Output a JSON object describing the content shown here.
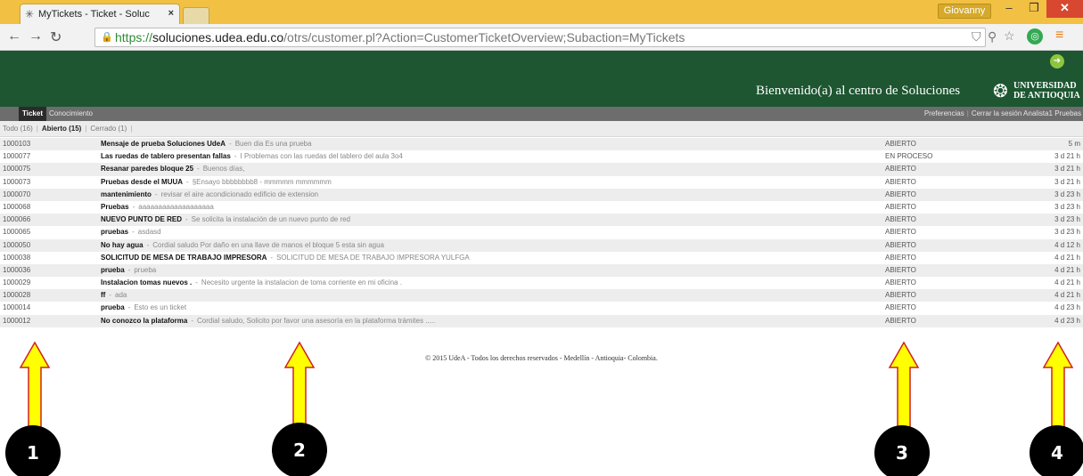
{
  "browser": {
    "tab_title": "MyTickets - Ticket - Soluc",
    "tab_close": "×",
    "user": "Giovanny",
    "window_min": "–",
    "window_max": "❐",
    "window_close": "✕",
    "url_scheme": "https://",
    "url_host": "soluciones.udea.edu.co",
    "url_path": "/otrs/customer.pl?Action=CustomerTicketOverview;Subaction=MyTickets"
  },
  "header": {
    "welcome": "Bienvenido(a) al centro de Soluciones",
    "logo_line1": "UNIVERSIDAD",
    "logo_line2": "DE ANTIOQUIA",
    "colors": {
      "header_bg": "#1d5631",
      "menubar_bg": "#6d6d6d",
      "titlebar": "#f2c043"
    }
  },
  "menu": {
    "items": [
      "Ticket",
      "Conocimiento"
    ],
    "preferences": "Preferencias",
    "logout": "Cerrar la sesión Analista1 Pruebas"
  },
  "filters": [
    {
      "label": "Todo (16)"
    },
    {
      "label": "Abierto (15)"
    },
    {
      "label": "Cerrado (1)"
    }
  ],
  "tickets": [
    {
      "number": "1000103",
      "subject": "Mensaje de prueba Soluciones UdeA",
      "body": "Buen dia Es una prueba",
      "state": "ABIERTO",
      "age": "5 m"
    },
    {
      "number": "1000077",
      "subject": "Las ruedas de tablero presentan fallas",
      "body": "I Problemas con las ruedas del tablero del aula 3o4",
      "state": "EN PROCESO",
      "age": "3 d 21 h"
    },
    {
      "number": "1000075",
      "subject": "Resanar paredes bloque 25",
      "body": "Buenos días,",
      "state": "ABIERTO",
      "age": "3 d 21 h"
    },
    {
      "number": "1000073",
      "subject": "Pruebas desde el MUUA",
      "body": "§Ensayo bbbbbbbb8 - mmmmm mmmmmm",
      "state": "ABIERTO",
      "age": "3 d 21 h"
    },
    {
      "number": "1000070",
      "subject": "mantenimiento",
      "body": "revisar el aire acondicionado edificio de extension",
      "state": "ABIERTO",
      "age": "3 d 23 h"
    },
    {
      "number": "1000068",
      "subject": "Pruebas",
      "body": "aaaaaaaaaaaaaaaaaaa",
      "state": "ABIERTO",
      "age": "3 d 23 h"
    },
    {
      "number": "1000066",
      "subject": "NUEVO PUNTO DE RED",
      "body": "Se solicita la instalación de un nuevo punto de red",
      "state": "ABIERTO",
      "age": "3 d 23 h"
    },
    {
      "number": "1000065",
      "subject": "pruebas",
      "body": "asdasd",
      "state": "ABIERTO",
      "age": "3 d 23 h"
    },
    {
      "number": "1000050",
      "subject": "No hay agua",
      "body": "Cordial saludo Por daño en una llave de manos el bloque 5 esta sin agua",
      "state": "ABIERTO",
      "age": "4 d 12 h"
    },
    {
      "number": "1000038",
      "subject": "SOLICITUD DE MESA DE TRABAJO IMPRESORA",
      "body": "SOLICITUD DE MESA DE TRABAJO IMPRESORA YULFGA",
      "state": "ABIERTO",
      "age": "4 d 21 h"
    },
    {
      "number": "1000036",
      "subject": "prueba",
      "body": "prueba",
      "state": "ABIERTO",
      "age": "4 d 21 h"
    },
    {
      "number": "1000029",
      "subject": "Instalacion tomas nuevos .",
      "body": "Necesito urgente la instalacion de toma corriente en mi oficina .",
      "state": "ABIERTO",
      "age": "4 d 21 h"
    },
    {
      "number": "1000028",
      "subject": "ff",
      "body": "ada",
      "state": "ABIERTO",
      "age": "4 d 21 h"
    },
    {
      "number": "1000014",
      "subject": "prueba",
      "body": "Esto es un ticket",
      "state": "ABIERTO",
      "age": "4 d 23 h"
    },
    {
      "number": "1000012",
      "subject": "No conozco la plataforma",
      "body": "Cordial saludo, Solicito por favor una asesoría en la plataforma trámites .....",
      "state": "ABIERTO",
      "age": "4 d 23 h"
    }
  ],
  "footer": "© 2015 UdeA - Todos los derechos reservados - Medellín - Antioquia- Colombia.",
  "annotations": {
    "markers": [
      "1",
      "2",
      "3",
      "4"
    ],
    "arrow_color": "#ffff00",
    "arrow_outline": "#d22020"
  }
}
